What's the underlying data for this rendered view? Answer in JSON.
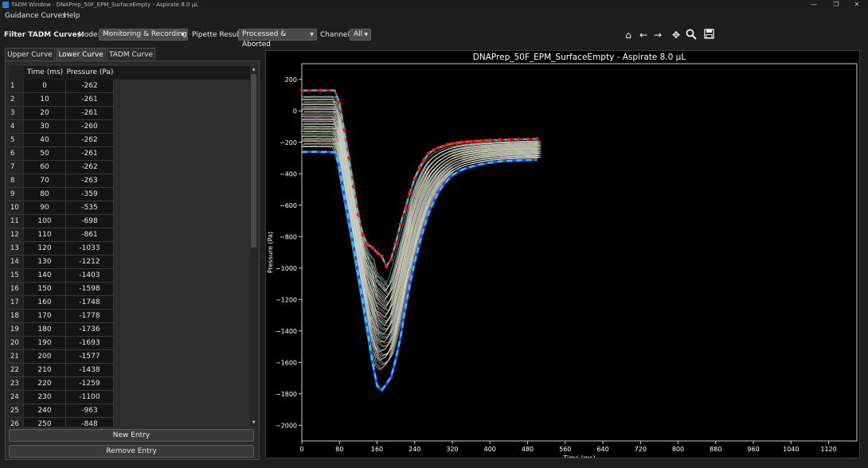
{
  "window": {
    "title": "TADM Window - DNAPrep_50F_EPM_SurfaceEmpty - Aspirate 8.0 µL",
    "controls": [
      "—",
      "❐",
      "✕"
    ]
  },
  "menu": [
    "Guidance Curves",
    "Help"
  ],
  "filters": {
    "label": "Filter TADM Curves:",
    "mode_label": "Mode:",
    "mode_value": "Monitoring & Recording",
    "pipette_label": "Pipette Result:",
    "pipette_value": "Processed & Aborted",
    "channel_label": "Channel:",
    "channel_value": "All"
  },
  "toolbar": [
    "home-icon",
    "back-arrow-icon",
    "forward-arrow-icon",
    "pan-icon",
    "zoom-icon",
    "save-icon"
  ],
  "tabs": [
    {
      "label": "Upper Curve",
      "active": false
    },
    {
      "label": "Lower Curve",
      "active": true
    },
    {
      "label": "TADM Curve",
      "active": false
    }
  ],
  "table": {
    "columns": [
      "Time (ms)",
      "Pressure (Pa)"
    ],
    "rows": [
      [
        "1",
        "0",
        "-262"
      ],
      [
        "2",
        "10",
        "-261"
      ],
      [
        "3",
        "20",
        "-261"
      ],
      [
        "4",
        "30",
        "-260"
      ],
      [
        "5",
        "40",
        "-262"
      ],
      [
        "6",
        "50",
        "-261"
      ],
      [
        "7",
        "60",
        "-262"
      ],
      [
        "8",
        "70",
        "-263"
      ],
      [
        "9",
        "80",
        "-359"
      ],
      [
        "10",
        "90",
        "-535"
      ],
      [
        "11",
        "100",
        "-698"
      ],
      [
        "12",
        "110",
        "-861"
      ],
      [
        "13",
        "120",
        "-1033"
      ],
      [
        "14",
        "130",
        "-1212"
      ],
      [
        "15",
        "140",
        "-1403"
      ],
      [
        "16",
        "150",
        "-1598"
      ],
      [
        "17",
        "160",
        "-1748"
      ],
      [
        "18",
        "170",
        "-1778"
      ],
      [
        "19",
        "180",
        "-1736"
      ],
      [
        "20",
        "190",
        "-1693"
      ],
      [
        "21",
        "200",
        "-1577"
      ],
      [
        "22",
        "210",
        "-1438"
      ],
      [
        "23",
        "220",
        "-1259"
      ],
      [
        "24",
        "230",
        "-1100"
      ],
      [
        "25",
        "240",
        "-963"
      ],
      [
        "26",
        "250",
        "-848"
      ]
    ]
  },
  "buttons": {
    "new_entry": "New Entry",
    "remove_entry": "Remove Entry"
  },
  "chart_data": {
    "type": "line",
    "title": "DNAPrep_50F_EPM_SurfaceEmpty - Aspirate 8.0 µL",
    "xlabel": "Time (ms)",
    "ylabel": "Pressure (Pa)",
    "xlim": [
      0,
      1180
    ],
    "ylim": [
      -2100,
      300
    ],
    "xticks": [
      0,
      80,
      160,
      240,
      320,
      400,
      480,
      560,
      640,
      720,
      800,
      880,
      960,
      1040,
      1120
    ],
    "yticks": [
      200,
      0,
      -200,
      -400,
      -600,
      -800,
      -1000,
      -1200,
      -1400,
      -1600,
      -1800,
      -2000
    ],
    "grid": false,
    "colors": {
      "upper": "#ff1a1a",
      "upper_dash": "#2fd0e0",
      "lower": "#1e4dff",
      "lower_dash": "#22d0ff",
      "tadm": [
        "#f5e6a0",
        "#9fd9b0",
        "#b8b8e8",
        "#f2b7b0",
        "#e8e0c0",
        "#a8d8d0"
      ]
    },
    "series": [
      {
        "name": "Upper Curve",
        "x": [
          0,
          10,
          20,
          30,
          40,
          50,
          60,
          70,
          80,
          90,
          100,
          110,
          120,
          130,
          140,
          150,
          160,
          170,
          180,
          190,
          200,
          210,
          220,
          230,
          240,
          250,
          260,
          270,
          280,
          290,
          300,
          310,
          320,
          330,
          340,
          350,
          360,
          370,
          380,
          390,
          400,
          420,
          440,
          460,
          480,
          500
        ],
        "y": [
          130,
          130,
          130,
          131,
          130,
          130,
          131,
          130,
          50,
          -120,
          -300,
          -480,
          -660,
          -790,
          -850,
          -870,
          -900,
          -925,
          -990,
          -940,
          -840,
          -720,
          -620,
          -520,
          -430,
          -360,
          -310,
          -270,
          -250,
          -235,
          -225,
          -215,
          -208,
          -204,
          -200,
          -197,
          -195,
          -193,
          -191,
          -189,
          -188,
          -185,
          -183,
          -181,
          -180,
          -178
        ]
      },
      {
        "name": "Lower Curve",
        "x": [
          0,
          10,
          20,
          30,
          40,
          50,
          60,
          70,
          80,
          90,
          100,
          110,
          120,
          130,
          140,
          150,
          160,
          170,
          180,
          190,
          200,
          210,
          220,
          230,
          240,
          250,
          260,
          270,
          280,
          290,
          300,
          310,
          320,
          340,
          360,
          380,
          400,
          420,
          440,
          460,
          480,
          500
        ],
        "y": [
          -262,
          -261,
          -261,
          -260,
          -262,
          -261,
          -262,
          -263,
          -359,
          -535,
          -698,
          -861,
          -1033,
          -1212,
          -1403,
          -1598,
          -1748,
          -1778,
          -1736,
          -1693,
          -1577,
          -1438,
          -1259,
          -1100,
          -963,
          -848,
          -740,
          -650,
          -580,
          -520,
          -475,
          -440,
          -410,
          -375,
          -355,
          -340,
          -330,
          -322,
          -318,
          -315,
          -313,
          -312
        ]
      }
    ]
  }
}
